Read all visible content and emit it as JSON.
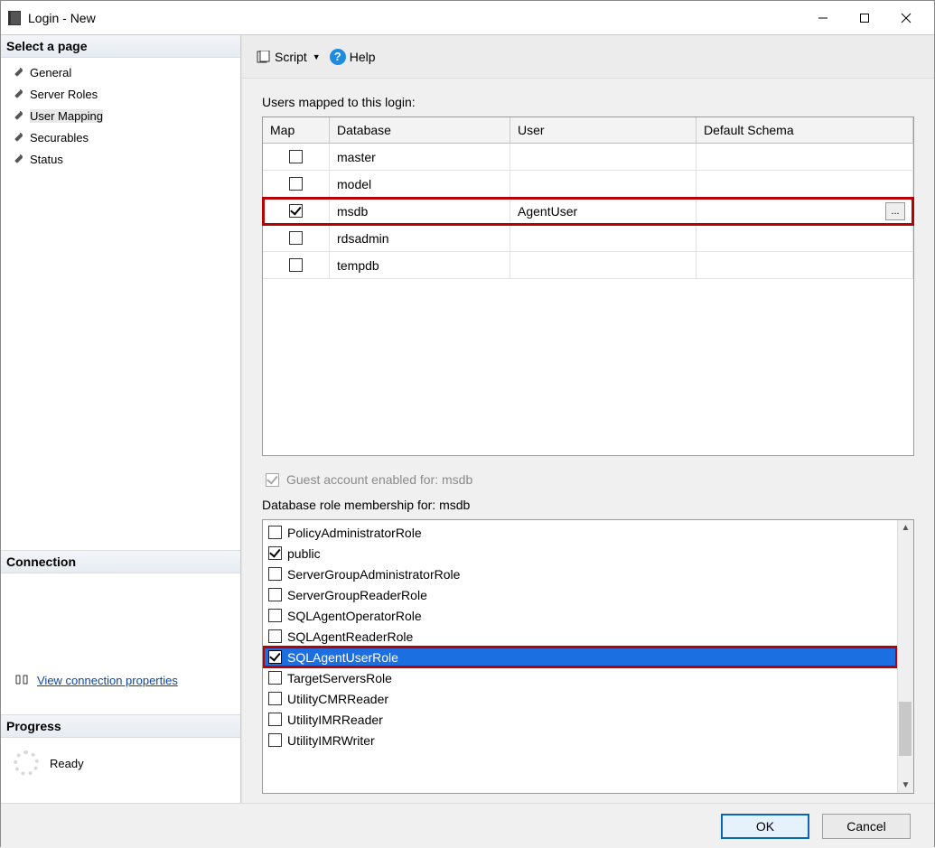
{
  "window": {
    "title": "Login - New"
  },
  "sidebar": {
    "selectPageHeader": "Select a page",
    "pages": [
      "General",
      "Server Roles",
      "User Mapping",
      "Securables",
      "Status"
    ],
    "selectedPage": "User Mapping",
    "connectionHeader": "Connection",
    "connLink": "View connection properties",
    "progressHeader": "Progress",
    "progressStatus": "Ready"
  },
  "toolbar": {
    "script": "Script",
    "help": "Help"
  },
  "mapping": {
    "label": "Users mapped to this login:",
    "columns": {
      "map": "Map",
      "database": "Database",
      "user": "User",
      "defaultSchema": "Default Schema"
    },
    "rows": [
      {
        "map": false,
        "database": "master",
        "user": "",
        "defaultSchema": "",
        "highlight": false
      },
      {
        "map": false,
        "database": "model",
        "user": "",
        "defaultSchema": "",
        "highlight": false
      },
      {
        "map": true,
        "database": "msdb",
        "user": "AgentUser",
        "defaultSchema": "",
        "highlight": true
      },
      {
        "map": false,
        "database": "rdsadmin",
        "user": "",
        "defaultSchema": "",
        "highlight": false
      },
      {
        "map": false,
        "database": "tempdb",
        "user": "",
        "defaultSchema": "",
        "highlight": false
      }
    ],
    "guestLabel": "Guest account enabled for: msdb",
    "guestChecked": true
  },
  "roles": {
    "label": "Database role membership for: msdb",
    "items": [
      {
        "name": "PolicyAdministratorRole",
        "checked": false,
        "selected": false,
        "highlight": false
      },
      {
        "name": "public",
        "checked": true,
        "selected": false,
        "highlight": false
      },
      {
        "name": "ServerGroupAdministratorRole",
        "checked": false,
        "selected": false,
        "highlight": false
      },
      {
        "name": "ServerGroupReaderRole",
        "checked": false,
        "selected": false,
        "highlight": false
      },
      {
        "name": "SQLAgentOperatorRole",
        "checked": false,
        "selected": false,
        "highlight": false
      },
      {
        "name": "SQLAgentReaderRole",
        "checked": false,
        "selected": false,
        "highlight": false
      },
      {
        "name": "SQLAgentUserRole",
        "checked": true,
        "selected": true,
        "highlight": true
      },
      {
        "name": "TargetServersRole",
        "checked": false,
        "selected": false,
        "highlight": false
      },
      {
        "name": "UtilityCMRReader",
        "checked": false,
        "selected": false,
        "highlight": false
      },
      {
        "name": "UtilityIMRReader",
        "checked": false,
        "selected": false,
        "highlight": false
      },
      {
        "name": "UtilityIMRWriter",
        "checked": false,
        "selected": false,
        "highlight": false
      }
    ]
  },
  "footer": {
    "ok": "OK",
    "cancel": "Cancel"
  }
}
